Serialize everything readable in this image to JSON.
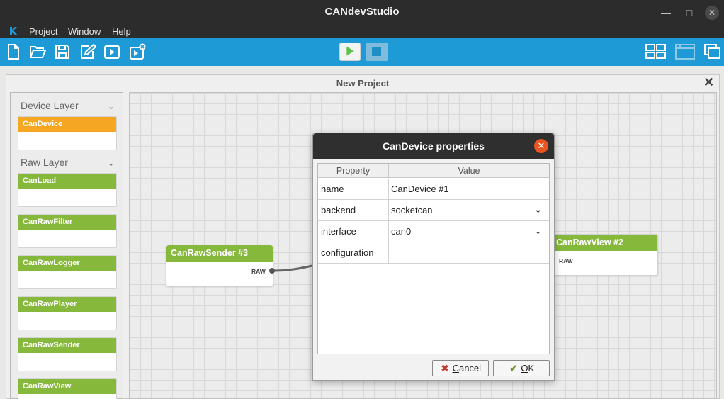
{
  "window": {
    "title": "CANdevStudio",
    "minimize_icon": "—",
    "maximize_icon": "□",
    "close_icon": "✕"
  },
  "menu": {
    "items": [
      "Project",
      "Window",
      "Help"
    ]
  },
  "toolbar": {
    "icons": [
      "new-file-icon",
      "open-folder-icon",
      "save-icon",
      "edit-icon",
      "run-icon",
      "stop-run-icon"
    ],
    "right_icons": [
      "grid-layout-icon",
      "window-icon",
      "cascade-windows-icon"
    ],
    "accent_color": "#1e9bd7"
  },
  "project": {
    "title": "New Project",
    "close_icon": "✕"
  },
  "palette": {
    "chevron": "⌄",
    "categories": [
      {
        "name": "Device Layer",
        "nodes": [
          "CanDevice"
        ]
      },
      {
        "name": "Raw Layer",
        "nodes": [
          "CanLoad",
          "CanRawFilter",
          "CanRawLogger",
          "CanRawPlayer",
          "CanRawSender",
          "CanRawView"
        ]
      }
    ]
  },
  "canvas": {
    "nodes": [
      {
        "title": "CanRawSender #3",
        "port": "RAW"
      },
      {
        "title": "CanRawView #2",
        "port": "RAW"
      }
    ]
  },
  "dialog": {
    "title": "CanDevice properties",
    "close_icon": "✕",
    "headers": {
      "property": "Property",
      "value": "Value"
    },
    "rows": [
      {
        "property": "name",
        "value": "CanDevice #1"
      },
      {
        "property": "backend",
        "value": "socketcan"
      },
      {
        "property": "interface",
        "value": "can0"
      },
      {
        "property": "configuration",
        "value": ""
      }
    ],
    "dropdown_chevron": "⌄",
    "cancel": {
      "icon": "✖",
      "accel": "C",
      "rest": "ancel"
    },
    "ok": {
      "icon": "✔",
      "accel": "O",
      "rest": "K"
    }
  }
}
